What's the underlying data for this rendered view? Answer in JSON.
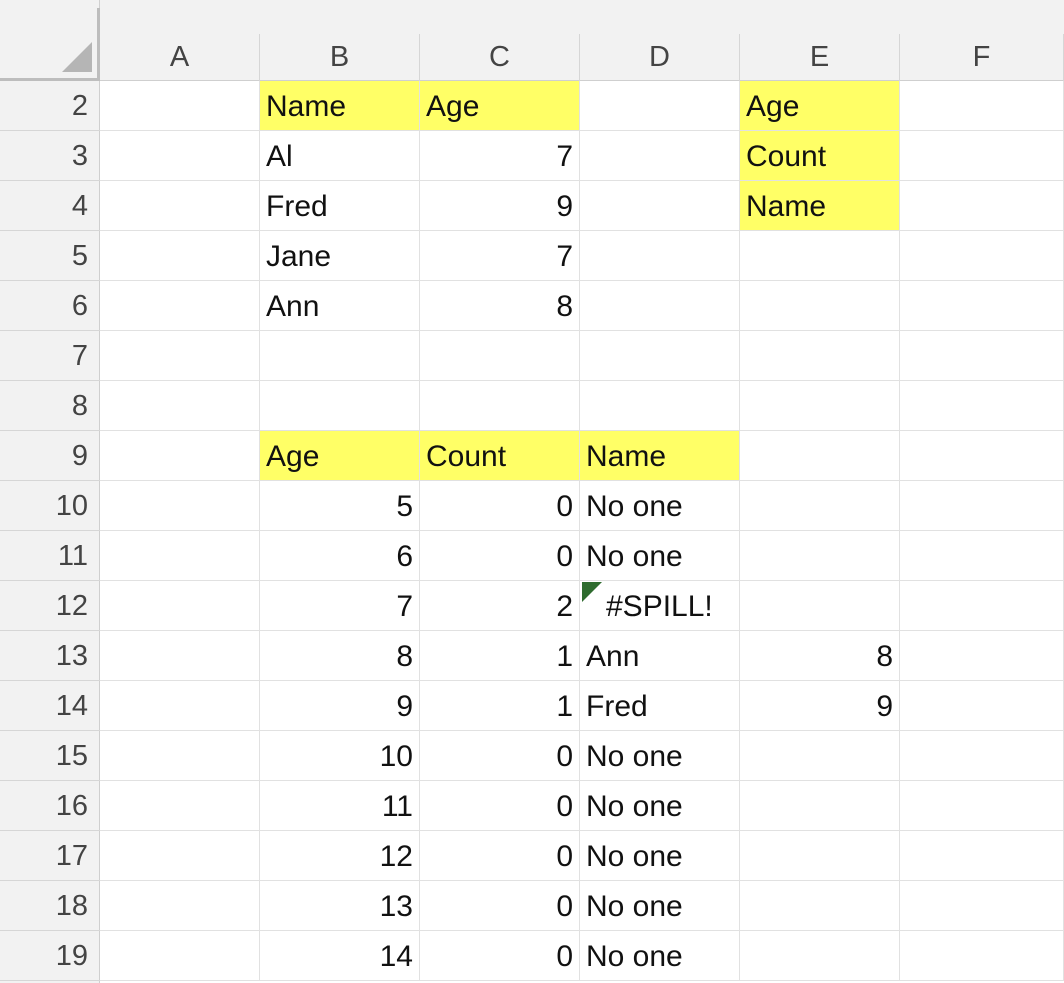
{
  "columns": [
    "A",
    "B",
    "C",
    "D",
    "E",
    "F"
  ],
  "rows": [
    "2",
    "3",
    "4",
    "5",
    "6",
    "7",
    "8",
    "9",
    "10",
    "11",
    "12",
    "13",
    "14",
    "15",
    "16",
    "17",
    "18",
    "19"
  ],
  "cells": {
    "B2": "Name",
    "C2": "Age",
    "E2": "Age",
    "B3": "Al",
    "C3": "7",
    "E3": "Count",
    "B4": "Fred",
    "C4": "9",
    "E4": "Name",
    "B5": "Jane",
    "C5": "7",
    "B6": "Ann",
    "C6": "8",
    "B9": "Age",
    "C9": "Count",
    "D9": "Name",
    "B10": "5",
    "C10": "0",
    "D10": "No one",
    "B11": "6",
    "C11": "0",
    "D11": "No one",
    "B12": "7",
    "C12": "2",
    "D12": "#SPILL!",
    "B13": "8",
    "C13": "1",
    "D13": "Ann",
    "E13": "8",
    "B14": "9",
    "C14": "1",
    "D14": "Fred",
    "E14": "9",
    "B15": "10",
    "C15": "0",
    "D15": "No one",
    "B16": "11",
    "C16": "0",
    "D16": "No one",
    "B17": "12",
    "C17": "0",
    "D17": "No one",
    "B18": "13",
    "C18": "0",
    "D18": "No one",
    "B19": "14",
    "C19": "0",
    "D19": "No one"
  },
  "highlight_color": "#ffff66",
  "error_flag_color": "#2e6b2e"
}
